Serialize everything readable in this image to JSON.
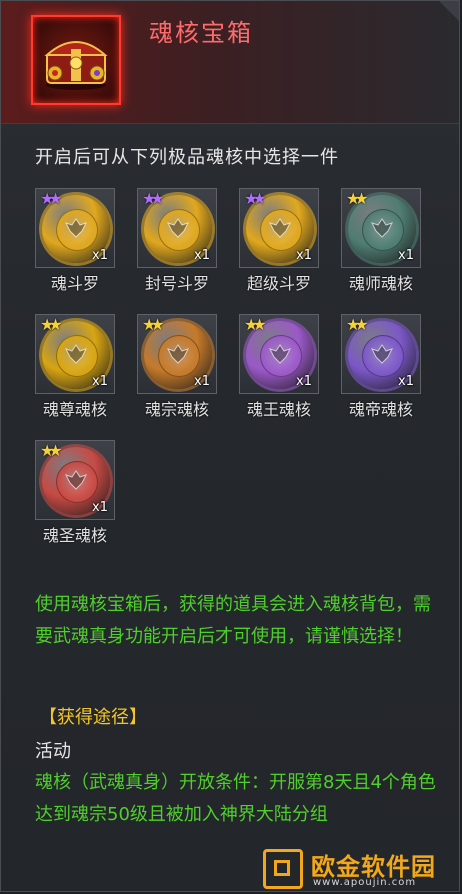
{
  "header": {
    "title": "魂核宝箱",
    "icon": "treasure-chest-icon"
  },
  "subtitle": "开启后可从下列极品魂核中选择一件",
  "items": [
    {
      "label": "魂斗罗",
      "qty": "x1",
      "stars": 2,
      "star_color": "#b06cff",
      "coin_color": "#e0a81e",
      "icon": "soul-core-purple-gold-icon"
    },
    {
      "label": "封号斗罗",
      "qty": "x1",
      "stars": 2,
      "star_color": "#b06cff",
      "coin_color": "#e0a81e",
      "icon": "soul-core-purple-gold-icon"
    },
    {
      "label": "超级斗罗",
      "qty": "x1",
      "stars": 2,
      "star_color": "#b06cff",
      "coin_color": "#e0a81e",
      "icon": "soul-core-purple-gold-icon"
    },
    {
      "label": "魂师魂核",
      "qty": "x1",
      "stars": 2,
      "star_color": "#f4d23a",
      "coin_color": "#4f7d72",
      "icon": "soul-core-teal-icon"
    },
    {
      "label": "魂尊魂核",
      "qty": "x1",
      "stars": 2,
      "star_color": "#f4d23a",
      "coin_color": "#d8a512",
      "icon": "soul-core-gold-icon"
    },
    {
      "label": "魂宗魂核",
      "qty": "x1",
      "stars": 2,
      "star_color": "#f4d23a",
      "coin_color": "#c67a2a",
      "icon": "soul-core-bronze-icon"
    },
    {
      "label": "魂王魂核",
      "qty": "x1",
      "stars": 2,
      "star_color": "#f4d23a",
      "coin_color": "#9b59c9",
      "icon": "soul-core-violet-icon"
    },
    {
      "label": "魂帝魂核",
      "qty": "x1",
      "stars": 2,
      "star_color": "#f4d23a",
      "coin_color": "#7c58c8",
      "icon": "soul-core-indigo-icon"
    },
    {
      "label": "魂圣魂核",
      "qty": "x1",
      "stars": 2,
      "star_color": "#f4d23a",
      "coin_color": "#c84a44",
      "icon": "soul-core-red-icon"
    }
  ],
  "description": "使用魂核宝箱后，获得的道具会进入魂核背包，需要武魂真身功能开启后才可使用，请谨慎选择！",
  "source_heading": "【获得途径】",
  "activity_label": "活动",
  "condition": "魂核（武魂真身）开放条件：开服第8天且4个角色达到魂宗50级且被加入神界大陆分组",
  "watermark": {
    "name": "欧金软件园",
    "url": "www.apoujin.com",
    "color": "#f2a81a"
  },
  "colors": {
    "title": "#ff6a6a",
    "green_text": "#4fcf2b",
    "gold_text": "#f3c52b",
    "frame_glow": "#ff3b2f"
  }
}
